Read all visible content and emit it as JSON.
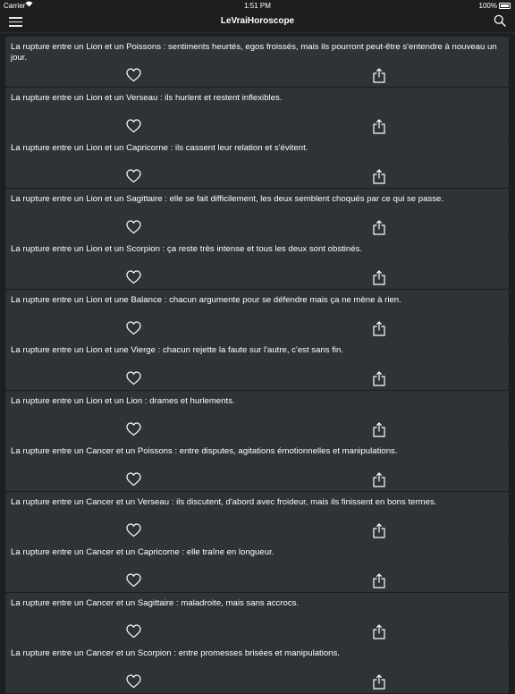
{
  "status": {
    "carrier": "Carrier",
    "time": "1:51 PM",
    "battery": "100%"
  },
  "header": {
    "title": "LeVraiHoroscope",
    "menu_icon": "hamburger-icon",
    "search_icon": "search-icon"
  },
  "items": [
    {
      "text": "La rupture entre un Lion et un Poissons : sentiments heurtés, egos froissés, mais ils pourront peut-être s'entendre à nouveau un jour."
    },
    {
      "text": "La rupture entre un Lion et un Verseau : ils hurlent et restent inflexibles."
    },
    {
      "text": "La rupture entre un Lion et un Capricorne : ils cassent leur relation et s'évitent."
    },
    {
      "text": "La rupture entre un Lion et un Sagittaire : elle se fait difficilement, les deux semblent choqués par ce qui se passe."
    },
    {
      "text": "La rupture entre un Lion et un Scorpion : ça reste très intense et tous les deux sont obstinés."
    },
    {
      "text": "La rupture entre un Lion et une Balance : chacun argumente pour se défendre mais ça ne mène à rien."
    },
    {
      "text": "La rupture entre un Lion et une Vierge : chacun rejette la faute sur l'autre, c'est sans fin."
    },
    {
      "text": "La rupture entre un Lion et un Lion : drames et hurlements."
    },
    {
      "text": "La rupture entre un Cancer et un Poissons : entre disputes, agitations émotionnelles et manipulations."
    },
    {
      "text": "La rupture entre un Cancer et un Verseau : ils discutent, d'abord avec froideur, mais ils finissent en bons termes."
    },
    {
      "text": "La rupture entre un Cancer et un Capricorne : elle traîne en longueur."
    },
    {
      "text": "La rupture entre un Cancer et un Sagittaire : maladroite, mais sans accrocs."
    },
    {
      "text": "La rupture entre un Cancer et un Scorpion : entre promesses brisées et manipulations."
    }
  ]
}
